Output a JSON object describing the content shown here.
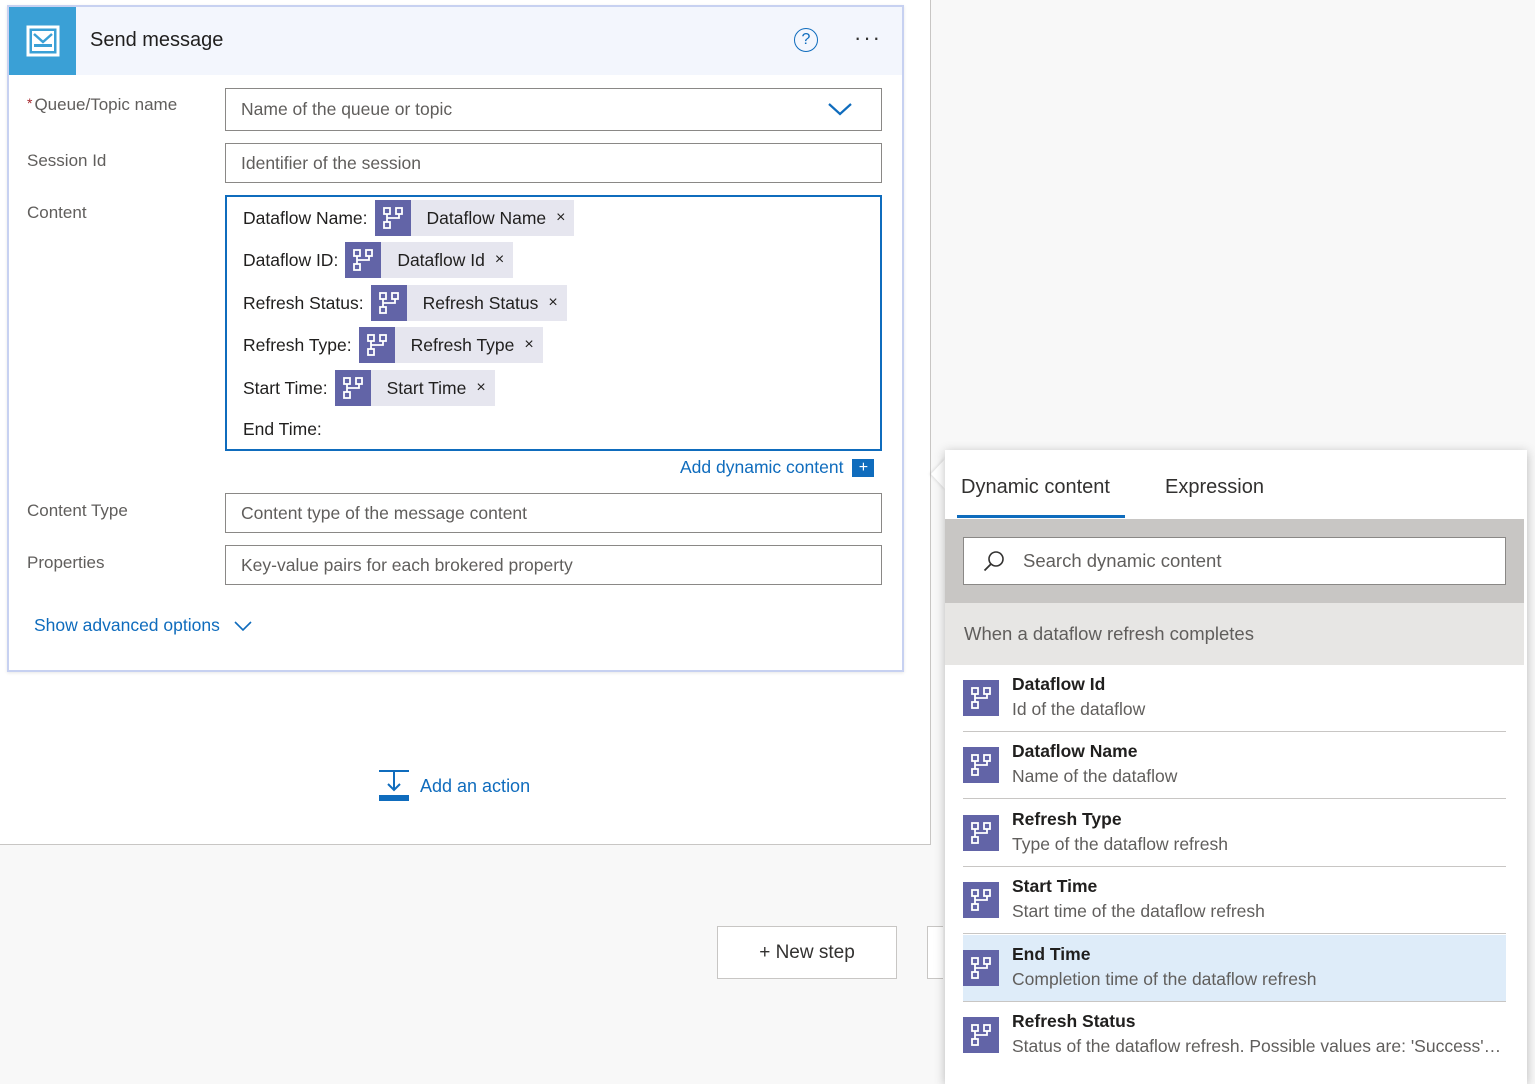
{
  "card": {
    "title": "Send message",
    "help_glyph": "?",
    "more_glyph": "···"
  },
  "fields": {
    "queue": {
      "label": "Queue/Topic name",
      "required_mark": "*",
      "placeholder": "Name of the queue or topic"
    },
    "session": {
      "label": "Session Id",
      "placeholder": "Identifier of the session"
    },
    "content": {
      "label": "Content"
    },
    "content_type": {
      "label": "Content Type",
      "placeholder": "Content type of the message content"
    },
    "properties": {
      "label": "Properties",
      "placeholder": "Key-value pairs for each brokered property"
    }
  },
  "content_lines": [
    {
      "label": "Dataflow Name:",
      "token": "Dataflow Name"
    },
    {
      "label": "Dataflow ID:",
      "token": "Dataflow Id"
    },
    {
      "label": "Refresh Status:",
      "token": "Refresh Status"
    },
    {
      "label": "Refresh Type:",
      "token": "Refresh Type"
    },
    {
      "label": "Start Time:",
      "token": "Start Time"
    },
    {
      "label": "End Time:"
    }
  ],
  "token_remove_glyph": "×",
  "add_dynamic": {
    "label": "Add dynamic content",
    "plus": "+"
  },
  "show_advanced": "Show advanced options",
  "add_action": "Add an action",
  "new_step": "+ New step",
  "panel": {
    "tabs": [
      "Dynamic content",
      "Expression"
    ],
    "active_tab": "Dynamic content",
    "search_placeholder": "Search dynamic content",
    "group": "When a dataflow refresh completes",
    "items": [
      {
        "title": "Dataflow Id",
        "desc": "Id of the dataflow"
      },
      {
        "title": "Dataflow Name",
        "desc": "Name of the dataflow"
      },
      {
        "title": "Refresh Type",
        "desc": "Type of the dataflow refresh"
      },
      {
        "title": "Start Time",
        "desc": "Start time of the dataflow refresh"
      },
      {
        "title": "End Time",
        "desc": "Completion time of the dataflow refresh",
        "selected": true
      },
      {
        "title": "Refresh Status",
        "desc": "Status of the dataflow refresh. Possible values are: 'Success', '..."
      }
    ]
  },
  "colors": {
    "accent": "#0f6cbd",
    "service_bus": "#3aa0d6",
    "dataflow": "#6264a7",
    "selected_row": "#deecf9"
  },
  "icons": {
    "card": "service-bus-icon",
    "token": "dataflow-icon",
    "search": "search-icon",
    "dropdown": "chevron-down-icon",
    "add_action": "add-action-icon"
  }
}
